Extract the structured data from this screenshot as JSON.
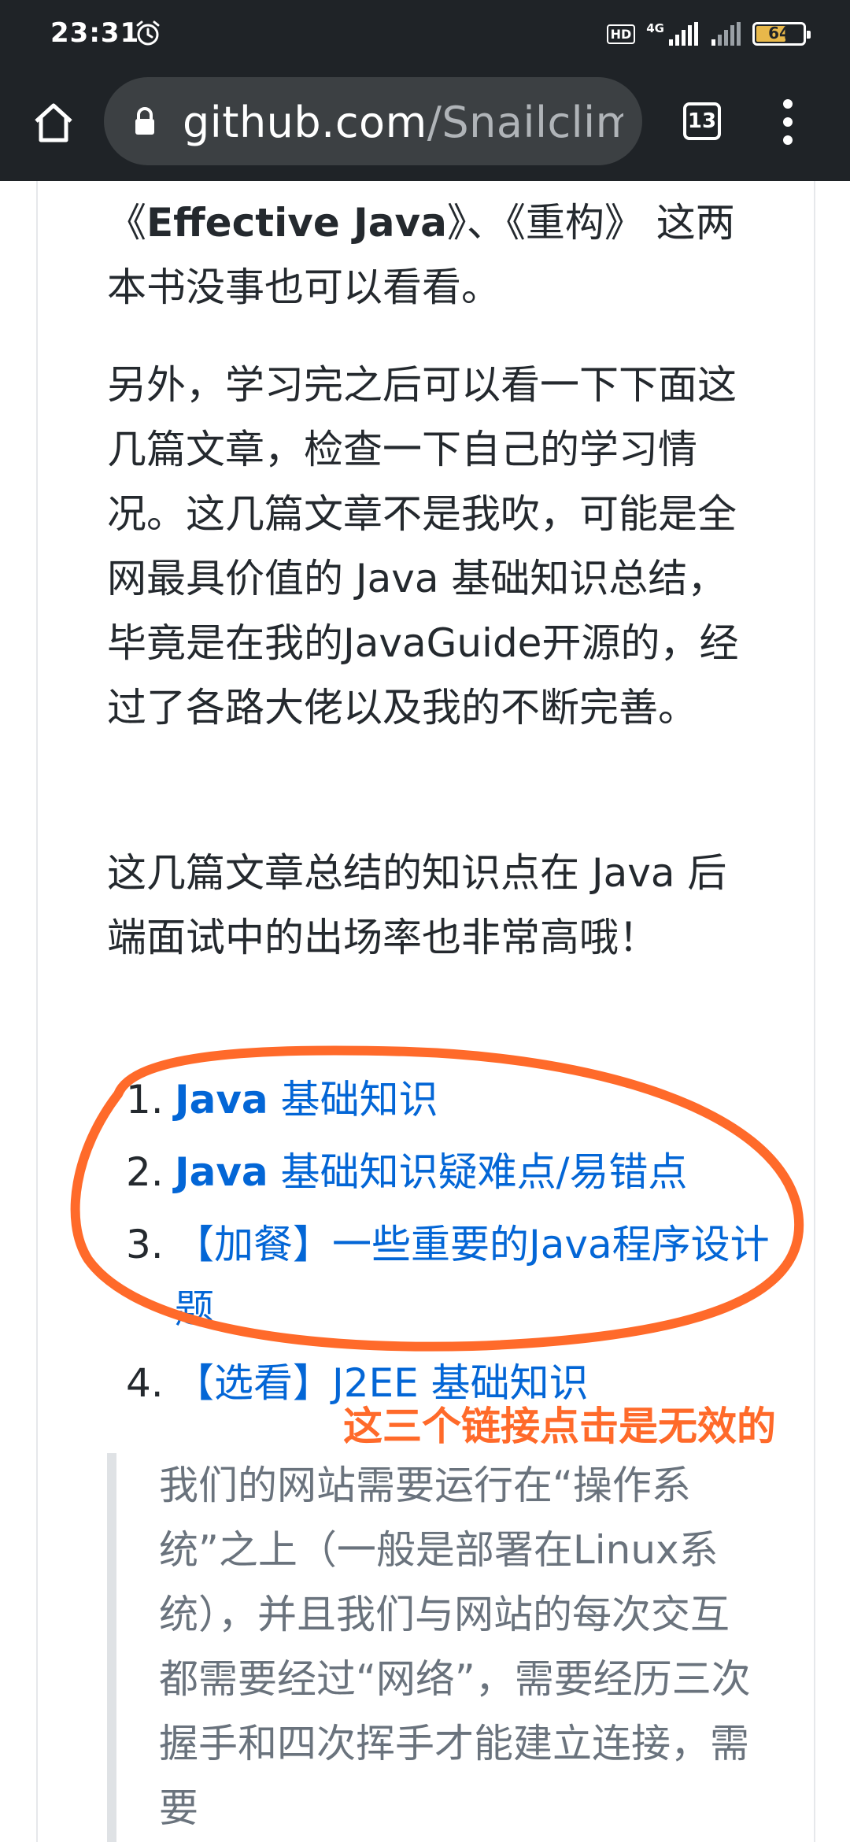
{
  "status_bar": {
    "time": "23:31",
    "hd": "HD",
    "network": "4G",
    "battery": "64",
    "battery_level": 0.64
  },
  "browser": {
    "url_domain": "github.com",
    "url_path": "/Snailclimb",
    "tab_count": "13"
  },
  "article": {
    "p1_a": "《",
    "p1_bold": "Effective Java",
    "p1_b": "》、《重构》 这两本书没事也可以看看。",
    "p2": "另外，学习完之后可以看一下下面这几篇文章，检查一下自己的学习情况。这几篇文章不是我吹，可能是全网最具价值的 Java 基础知识总结，毕竟是在我的JavaGuide开源的，经过了各路大佬以及我的不断完善。",
    "p3": "这几篇文章总结的知识点在 Java 后端面试中的出场率也非常高哦！",
    "list": [
      {
        "num": "1.",
        "bold": "Java",
        "text": " 基础知识"
      },
      {
        "num": "2.",
        "bold": "Java",
        "text": " 基础知识疑难点/易错点"
      },
      {
        "num": "3.",
        "bold": "",
        "text": "【加餐】一些重要的Java程序设计题"
      },
      {
        "num": "4.",
        "bold": "",
        "text": "【选看】J2EE 基础知识"
      }
    ],
    "quote": "我们的网站需要运行在“操作系统”之上（一般是部署在Linux系统），并且我们与网站的每次交互都需要经过“网络”，需要经历三次握手和四次挥手才能建立连接，需要"
  },
  "annotation": {
    "text": "这三个链接点击是无效的",
    "color": "#ff6a2a"
  }
}
